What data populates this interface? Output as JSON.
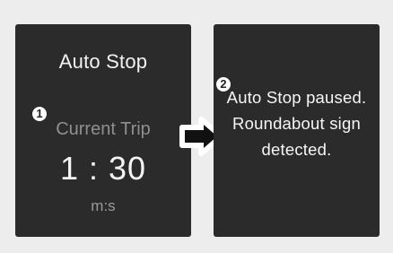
{
  "auto_stop_screen": {
    "title": "Auto Stop",
    "trip_label": "Current Trip",
    "time": "1 : 30",
    "unit": "m:s",
    "marker": "1"
  },
  "paused_screen": {
    "marker": "2",
    "message_line_1": "Auto Stop paused.",
    "message_line_2": "Roundabout sign",
    "message_line_3": "detected."
  },
  "transition_icon": "arrow-right-icon",
  "colors": {
    "background": "#ededed",
    "screen": "#2b2b2b",
    "text": "#f2f2f2",
    "muted_text": "#8f8f8f"
  }
}
